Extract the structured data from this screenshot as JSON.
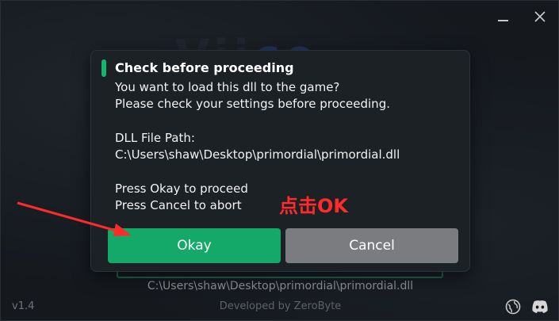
{
  "window": {
    "logo_text": "Vii",
    "logo_accent": "ce",
    "minimize_icon": "minimize-icon",
    "close_icon": "close-icon"
  },
  "background": {
    "dll_path": "C:\\Users\\shaw\\Desktop\\primordial\\primordial.dll",
    "version": "v1.4",
    "developer": "Developed by ZeroByte",
    "globe_icon": "globe-icon",
    "discord_icon": "discord-icon"
  },
  "dialog": {
    "title": "Check before proceeding",
    "accent_color": "#19b46b",
    "lines": [
      "You want to load this dll to the game?",
      "Please check your settings before proceeding.",
      "",
      "DLL File Path:",
      "C:\\Users\\shaw\\Desktop\\primordial\\primordial.dll",
      "",
      "Press Okay to proceed",
      "Press Cancel to abort"
    ],
    "okay_label": "Okay",
    "cancel_label": "Cancel",
    "okay_color": "#14a968",
    "cancel_color": "#7a7c7f"
  },
  "annotation": {
    "text": "点击OK",
    "color": "#ff2a2a"
  }
}
